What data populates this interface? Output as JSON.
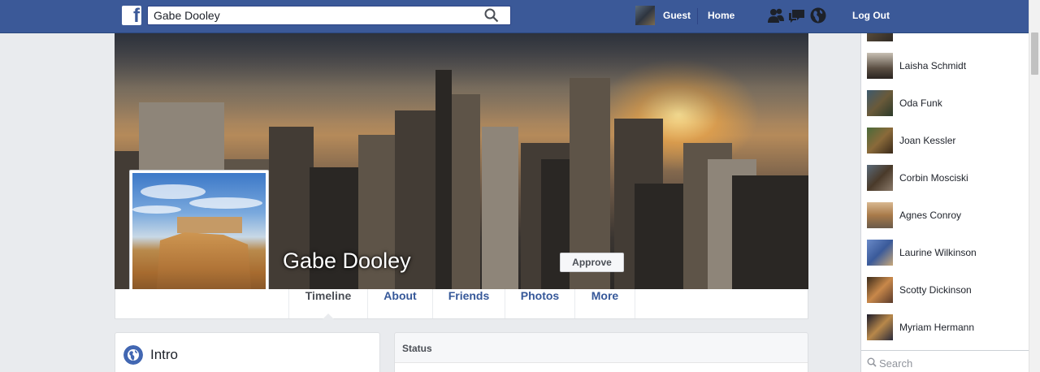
{
  "header": {
    "logo_icon": "facebook-f-icon",
    "search": {
      "value": "Gabe Dooley",
      "icon": "search-icon"
    },
    "nav": {
      "guest_label": "Guest",
      "home_label": "Home",
      "logout_label": "Log Out"
    },
    "icons": [
      "friends-icon",
      "messages-icon",
      "notifications-globe-icon"
    ]
  },
  "profile": {
    "name": "Gabe Dooley",
    "approve_label": "Approve"
  },
  "tabs": [
    {
      "label": "Timeline",
      "active": true
    },
    {
      "label": "About"
    },
    {
      "label": "Friends"
    },
    {
      "label": "Photos"
    },
    {
      "label": "More"
    }
  ],
  "intro": {
    "title": "Intro",
    "icon": "globe-icon"
  },
  "status": {
    "title": "Status"
  },
  "chat": {
    "contacts": [
      {
        "name": ""
      },
      {
        "name": "Laisha Schmidt"
      },
      {
        "name": "Oda Funk"
      },
      {
        "name": "Joan Kessler"
      },
      {
        "name": "Corbin Mosciski"
      },
      {
        "name": "Agnes Conroy"
      },
      {
        "name": "Laurine Wilkinson"
      },
      {
        "name": "Scotty Dickinson"
      },
      {
        "name": "Myriam Hermann"
      }
    ],
    "search_placeholder": "Search"
  },
  "colors": {
    "brand": "#3b5998",
    "link": "#365899",
    "background": "#e9ebee"
  }
}
